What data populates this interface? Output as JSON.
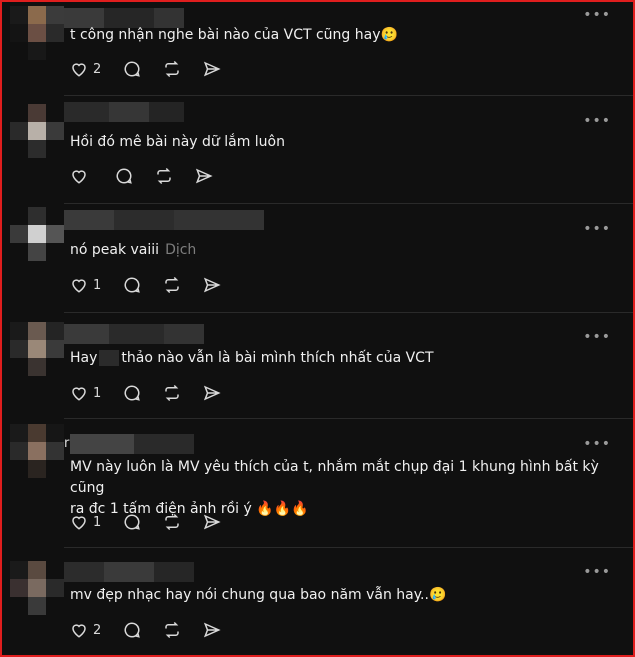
{
  "comments": [
    {
      "text": "t công nhận nghe bài nào của VCT cũng hay",
      "emoji": "🥲",
      "likes": "2"
    },
    {
      "text": "Hồi đó mê bài này dữ lắm luôn",
      "likes": ""
    },
    {
      "text": "nó peak vaiii",
      "translate": "Dịch",
      "likes": "1"
    },
    {
      "text_before": "Hay",
      "text_after": "thảo nào vẫn là bài mình thích nhất của VCT",
      "likes": "1"
    },
    {
      "name_initial": "r",
      "line1": "MV này luôn là MV yêu thích của t, nhắm mắt chụp đại 1 khung hình bất kỳ cũng",
      "line2": "ra đc 1 tấm điện ảnh rồi ý ",
      "emoji": "🔥🔥🔥",
      "likes": "1"
    },
    {
      "text": "mv đẹp nhạc hay nói chung qua bao năm vẫn hay..",
      "emoji": "🥲",
      "likes": "2"
    }
  ],
  "more_label": "•••",
  "colors": {
    "border": "#e01e1e",
    "background": "#101010",
    "text": "#f0f0f0",
    "muted": "#7d7d7d"
  },
  "icons": [
    "heart-icon",
    "reply-icon",
    "repost-icon",
    "share-icon",
    "more-icon"
  ]
}
